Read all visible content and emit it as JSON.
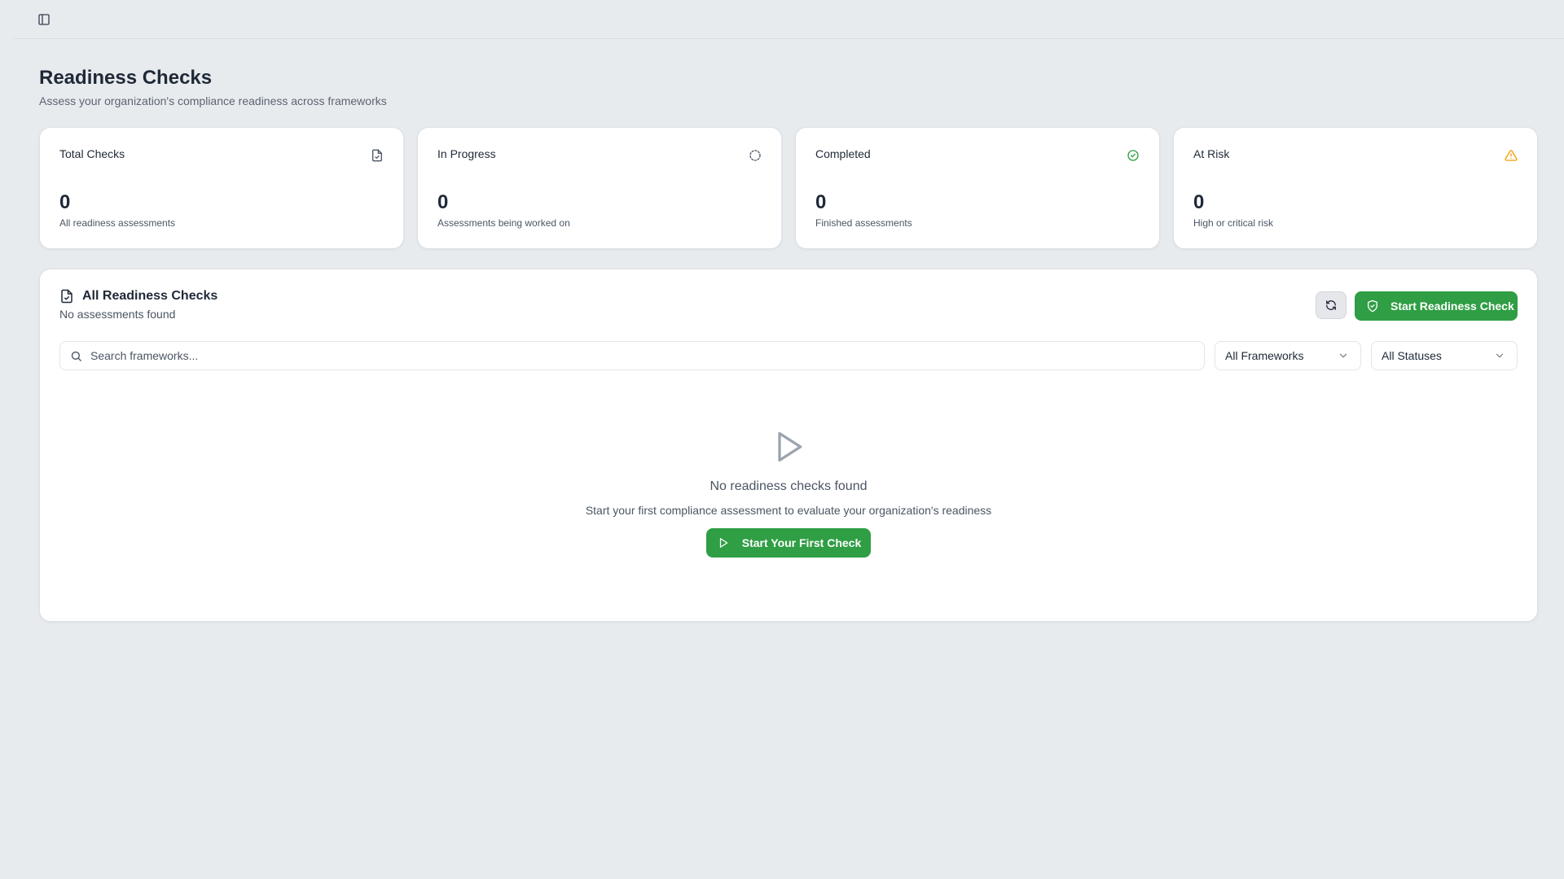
{
  "page": {
    "title": "Readiness Checks",
    "subtitle": "Assess your organization's compliance readiness across frameworks"
  },
  "stats": [
    {
      "label": "Total Checks",
      "value": "0",
      "desc": "All readiness assessments",
      "icon": "file-check-icon",
      "icon_color": "#4b5563"
    },
    {
      "label": "In Progress",
      "value": "0",
      "desc": "Assessments being worked on",
      "icon": "loader-icon",
      "icon_color": "#4b5563"
    },
    {
      "label": "Completed",
      "value": "0",
      "desc": "Finished assessments",
      "icon": "check-circle-icon",
      "icon_color": "#2f9e44"
    },
    {
      "label": "At Risk",
      "value": "0",
      "desc": "High or critical risk",
      "icon": "alert-triangle-icon",
      "icon_color": "#f59f00"
    }
  ],
  "list": {
    "title": "All Readiness Checks",
    "subtitle": "No assessments found",
    "start_button": "Start Readiness Check",
    "search_placeholder": "Search frameworks...",
    "framework_filter": "All Frameworks",
    "status_filter": "All Statuses"
  },
  "empty_state": {
    "title": "No readiness checks found",
    "description": "Start your first compliance assessment to evaluate your organization's readiness",
    "button": "Start Your First Check"
  },
  "colors": {
    "accent": "#2f9e44",
    "warning": "#f59f00",
    "background": "#e8ebee"
  }
}
